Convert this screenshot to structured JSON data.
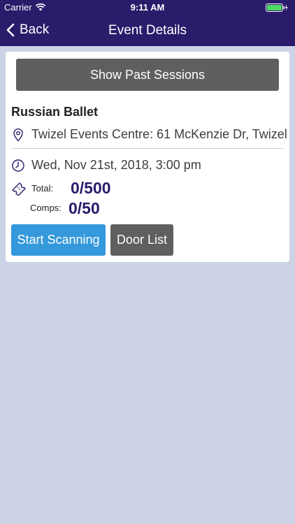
{
  "status_bar": {
    "carrier": "Carrier",
    "time": "9:11 AM",
    "wifi_icon": "wifi-icon",
    "battery_icon": "battery-icon"
  },
  "nav": {
    "back_label": "Back",
    "title": "Event Details",
    "back_icon": "chevron-left-icon"
  },
  "event": {
    "past_sessions_label": "Show Past Sessions",
    "name": "Russian Ballet",
    "venue": "Twizel Events Centre: 61 McKenzie Dr, Twizel",
    "venue_icon": "location-pin-icon",
    "datetime": "Wed, Nov 21st, 2018, 3:00 pm",
    "datetime_icon": "clock-icon",
    "ticket_icon": "ticket-icon",
    "total_label": "Total:",
    "total_value": "0/500",
    "comps_label": "Comps:",
    "comps_value": "0/50"
  },
  "actions": {
    "start_scanning_label": "Start Scanning",
    "door_list_label": "Door List"
  },
  "colors": {
    "header_bg": "#2a1b6b",
    "page_bg": "#cdd3e6",
    "primary_button": "#3498db",
    "secondary_button": "#5f5f5f",
    "count_text": "#2a1b6b"
  }
}
